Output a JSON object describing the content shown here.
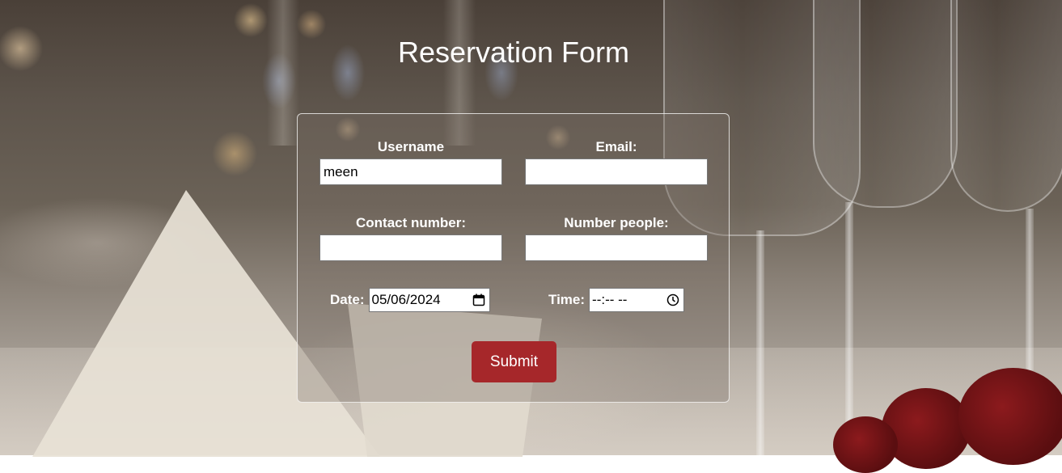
{
  "page": {
    "title": "Reservation Form"
  },
  "form": {
    "username": {
      "label": "Username",
      "value": "meen"
    },
    "email": {
      "label": "Email:",
      "value": ""
    },
    "contact": {
      "label": "Contact number:",
      "value": ""
    },
    "people": {
      "label": "Number people:",
      "value": ""
    },
    "date": {
      "label": "Date:",
      "value": "05/06/2024",
      "icon": "calendar-icon"
    },
    "time": {
      "label": "Time:",
      "value": "--:-- --",
      "icon": "clock-icon"
    },
    "submit_label": "Submit"
  },
  "colors": {
    "submit_button": "#a6272a",
    "text": "#ffffff"
  }
}
